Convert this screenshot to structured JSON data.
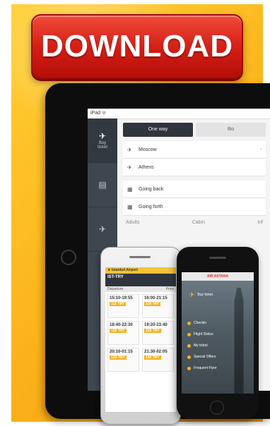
{
  "banner": {
    "download_label": "DOWNLOAD"
  },
  "tablet": {
    "status": "iPad ᯤ",
    "sidebar": [
      {
        "icon": "plane-icon",
        "label": "Buy\nticket"
      },
      {
        "icon": "document-icon",
        "label": ""
      },
      {
        "icon": "plane-icon",
        "label": ""
      }
    ],
    "tabs": [
      "One way",
      "Ro"
    ],
    "from": "Moscow",
    "to": "Athens",
    "depart": "Going back",
    "return": "Going forth",
    "cols": [
      "Adults",
      "Cabin",
      "Inf"
    ]
  },
  "android": {
    "bar": "Istanbul Airport",
    "head": "IST-TRY",
    "sub_left": "Departure",
    "sub_right": "Price",
    "cards": [
      {
        "time": "15:10-19:55",
        "price": "112 TRY"
      },
      {
        "time": "16:00-21:15",
        "price": "118 TRY"
      },
      {
        "time": "18:40-22:30",
        "price": "125 TRY"
      },
      {
        "time": "19:20-23:40",
        "price": "129 TRY"
      },
      {
        "time": "20:10-01:15",
        "price": "133 TRY"
      },
      {
        "time": "21:30-02:05",
        "price": "140 TRY"
      }
    ]
  },
  "iphone": {
    "top": "AIR ASTANA",
    "hero_label": "Buy ticket",
    "menu": [
      "Checkin",
      "Flight Status",
      "My ticket",
      "Special Offers",
      "Frequent Flyer"
    ]
  },
  "colors": {
    "accent": "#f6b21a",
    "button_red": "#d21d14"
  }
}
